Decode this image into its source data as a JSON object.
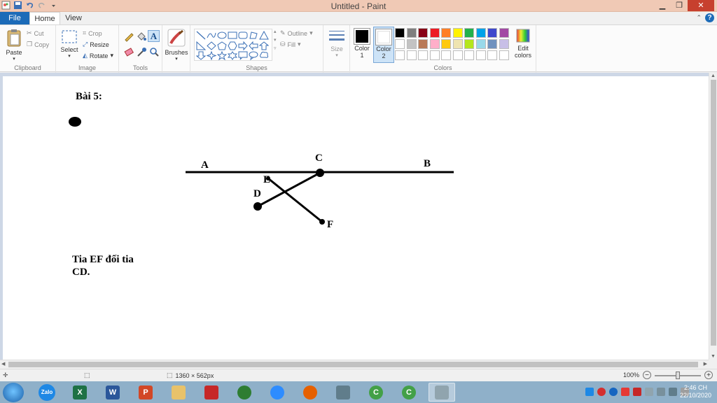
{
  "window": {
    "title": "Untitled - Paint",
    "buttons": [
      "minimize",
      "restore",
      "close"
    ]
  },
  "tabs": [
    {
      "label": "File"
    },
    {
      "label": "Home"
    },
    {
      "label": "View"
    }
  ],
  "ribbon": {
    "clipboard": {
      "label": "Clipboard",
      "paste": "Paste",
      "cut": "Cut",
      "copy": "Copy"
    },
    "image": {
      "label": "Image",
      "select": "Select",
      "crop": "Crop",
      "resize": "Resize",
      "rotate": "Rotate"
    },
    "tools": {
      "label": "Tools"
    },
    "brushes": {
      "label": "Brushes"
    },
    "shapes": {
      "label": "Shapes",
      "outline": "Outline",
      "fill": "Fill"
    },
    "size": {
      "label": "Size"
    },
    "colors": {
      "label": "Colors",
      "color1": "Color",
      "color1_num": "1",
      "color2": "Color",
      "color2_num": "2",
      "edit": "Edit",
      "edit2": "colors",
      "color1_value": "#000000",
      "color2_value": "#ffffff",
      "palette_row1": [
        "#000000",
        "#7f7f7f",
        "#880015",
        "#ed1c24",
        "#ff7f27",
        "#fff200",
        "#22b14c",
        "#00a2e8",
        "#3f48cc",
        "#a349a4"
      ],
      "palette_row2": [
        "#ffffff",
        "#c3c3c3",
        "#b97a57",
        "#ffaec9",
        "#ffc90e",
        "#efe4b0",
        "#b5e61d",
        "#99d9ea",
        "#7092be",
        "#c8bfe7"
      ],
      "palette_row3": [
        "#ffffff",
        "#ffffff",
        "#ffffff",
        "#ffffff",
        "#ffffff",
        "#ffffff",
        "#ffffff",
        "#ffffff",
        "#ffffff",
        "#ffffff"
      ]
    }
  },
  "drawing": {
    "heading": "Bài 5:",
    "label_a": "A",
    "label_b": "B",
    "label_c": "C",
    "label_d": "D",
    "label_e": "E",
    "label_f": "F",
    "answer_line1": "Tia EF đối tia",
    "answer_line2": "CD."
  },
  "status": {
    "dimensions": "1360 × 562px",
    "zoom": "100%"
  },
  "taskbar": {
    "apps": [
      {
        "name": "zalo",
        "glyph": "Zalo",
        "color": "#1e88e5"
      },
      {
        "name": "excel",
        "glyph": "X",
        "color": "#1e7145"
      },
      {
        "name": "word",
        "glyph": "W",
        "color": "#2b579a"
      },
      {
        "name": "powerpoint",
        "glyph": "P",
        "color": "#d24726"
      },
      {
        "name": "file-explorer",
        "glyph": "",
        "color": "#e8c26a"
      },
      {
        "name": "unikey",
        "glyph": "",
        "color": "#c62828"
      },
      {
        "name": "app-green",
        "glyph": "",
        "color": "#2e7d32"
      },
      {
        "name": "zoom",
        "glyph": "",
        "color": "#2d8cff"
      },
      {
        "name": "firefox",
        "glyph": "",
        "color": "#e66000"
      },
      {
        "name": "app-book",
        "glyph": "",
        "color": "#607d8b"
      },
      {
        "name": "app-c",
        "glyph": "C",
        "color": "#43a047"
      },
      {
        "name": "app-c2",
        "glyph": "C",
        "color": "#43a047"
      },
      {
        "name": "paint",
        "glyph": "",
        "color": "#90a4ae"
      }
    ],
    "clock_time": "2:46 CH",
    "clock_date": "22/10/2020"
  }
}
